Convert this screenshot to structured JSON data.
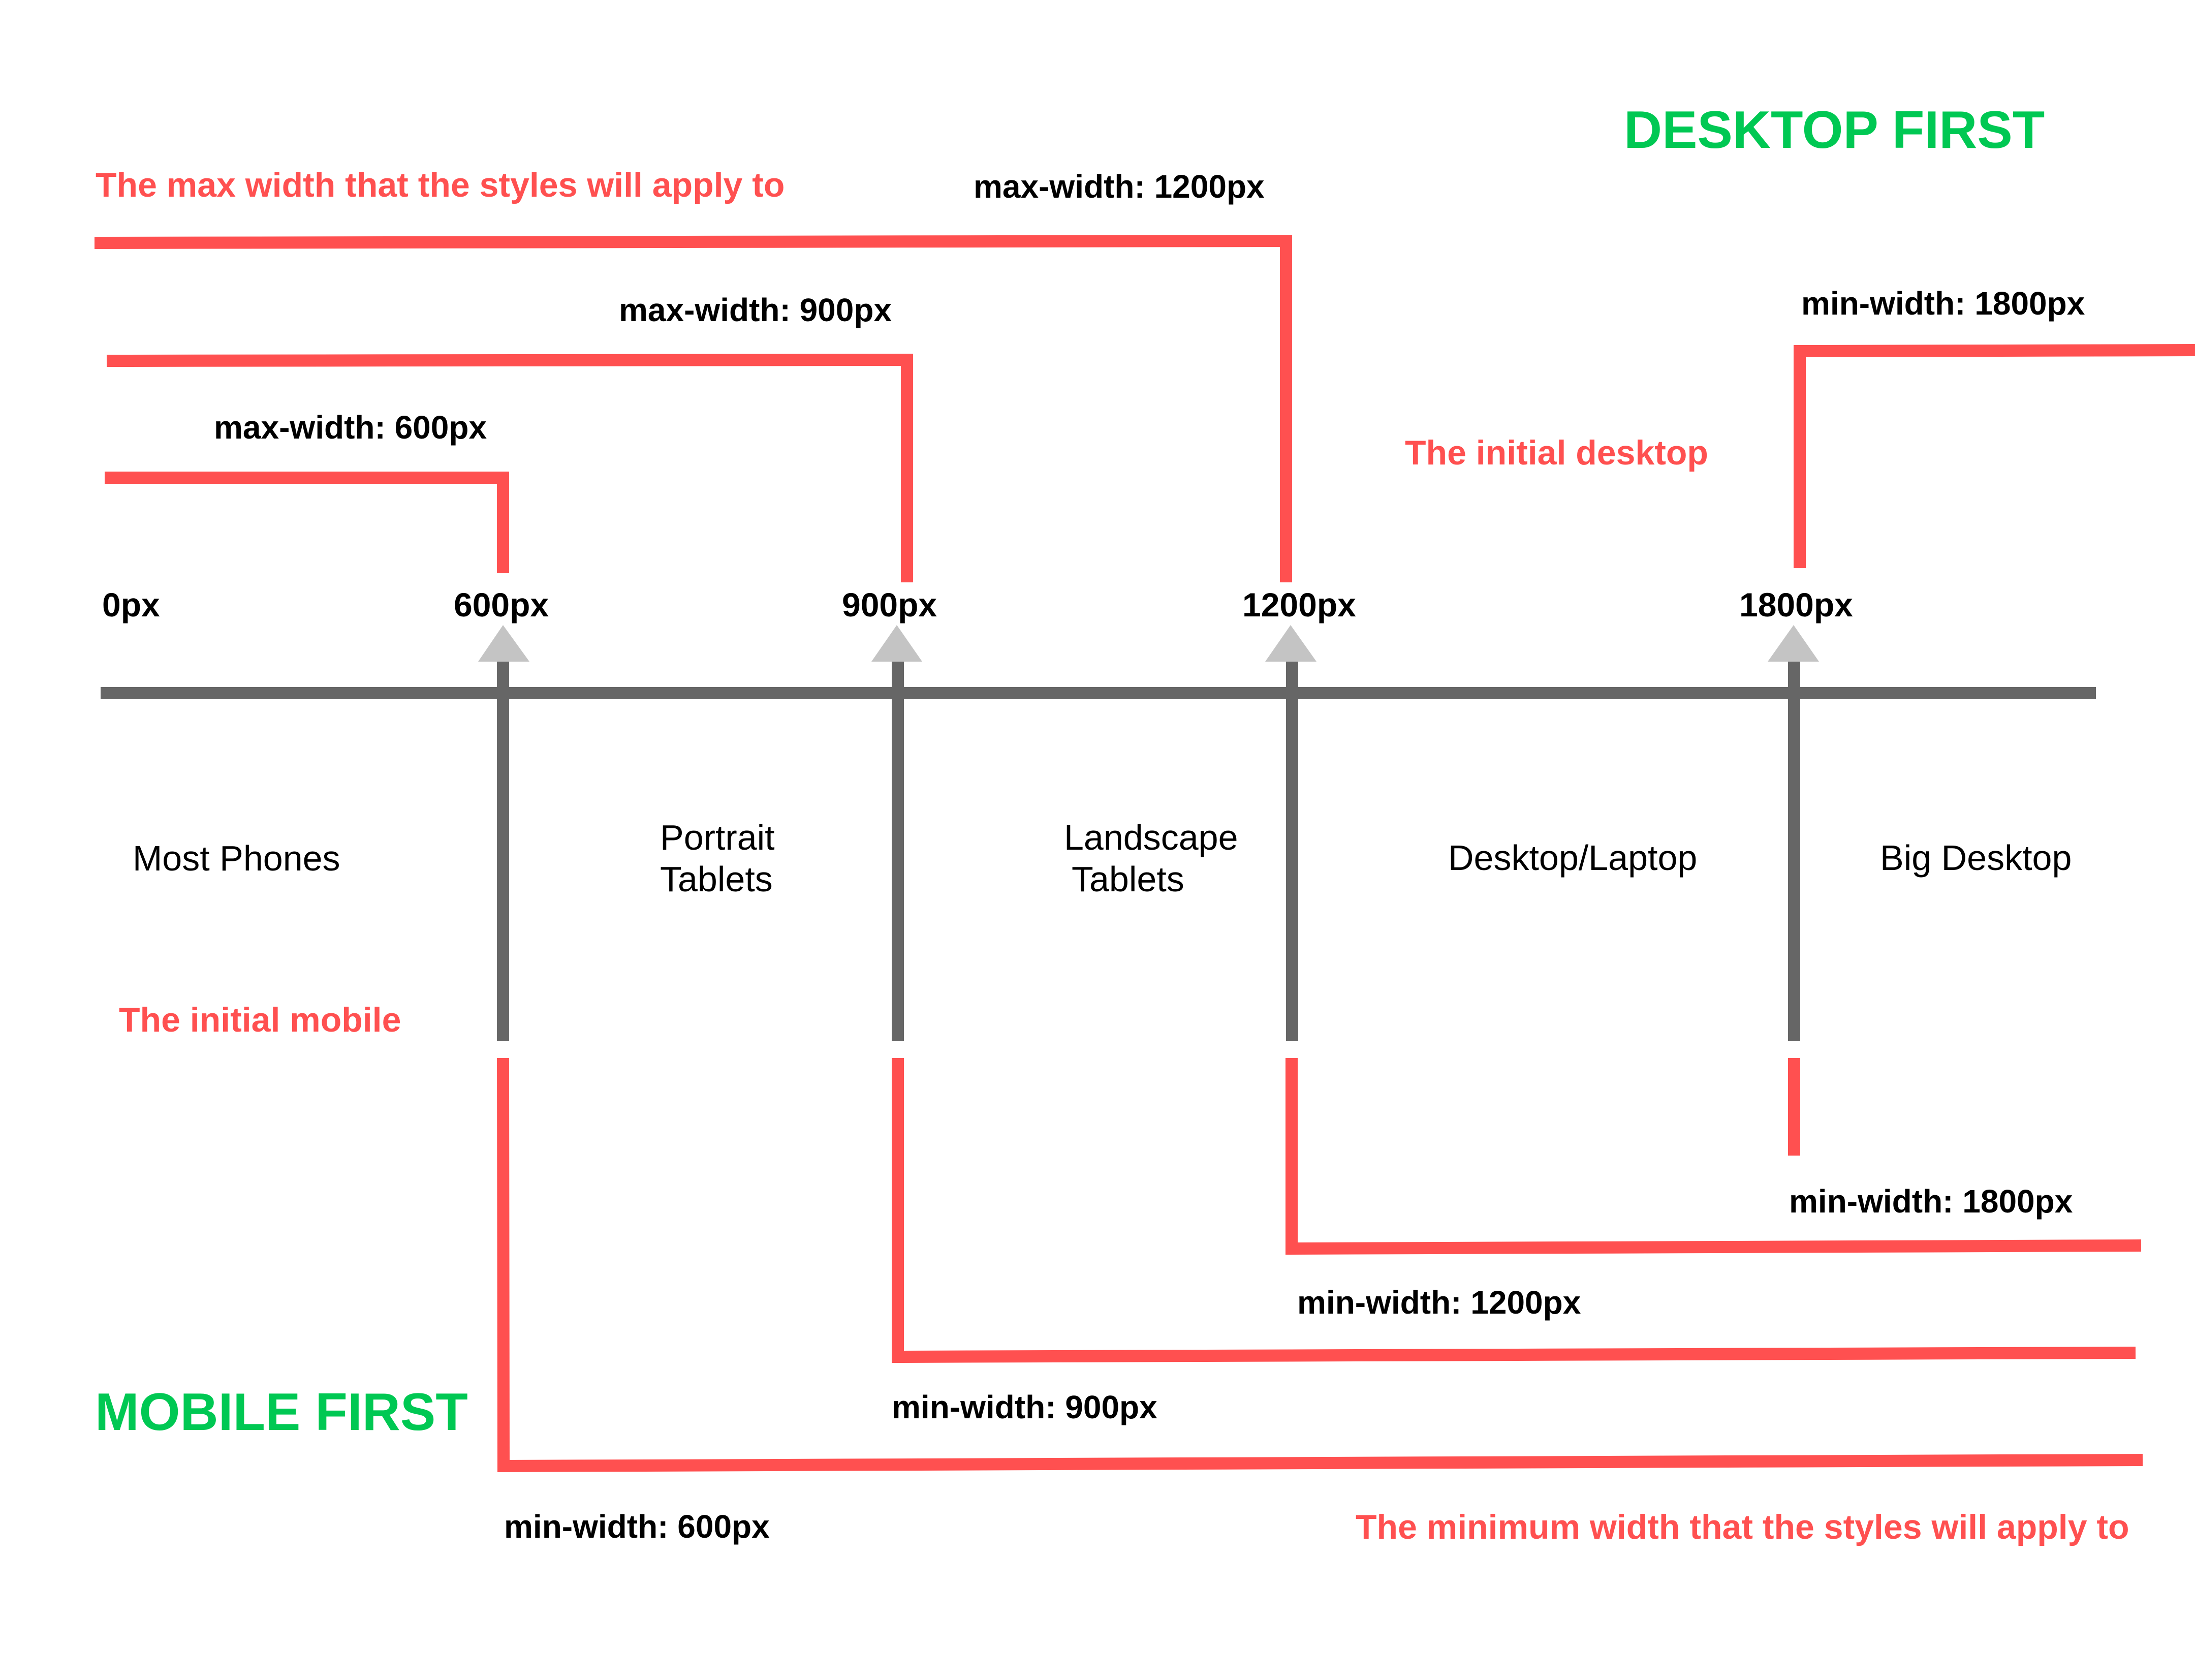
{
  "headings": {
    "desktop_first": "DESKTOP FIRST",
    "mobile_first": "MOBILE FIRST"
  },
  "notes": {
    "max_width_explainer": "The max width that the styles will apply to",
    "min_width_explainer": "The minimum width that the styles will apply to",
    "initial_desktop": "The initial desktop",
    "initial_mobile": "The initial mobile"
  },
  "axis": {
    "ticks": [
      {
        "label": "0px",
        "value": 0
      },
      {
        "label": "600px",
        "value": 600
      },
      {
        "label": "900px",
        "value": 900
      },
      {
        "label": "1200px",
        "value": 1200
      },
      {
        "label": "1800px",
        "value": 1800
      }
    ]
  },
  "devices": [
    {
      "line1": "Most Phones",
      "line2": ""
    },
    {
      "line1": "Portrait",
      "line2": "Tablets"
    },
    {
      "line1": "Landscape",
      "line2": "Tablets"
    },
    {
      "line1": "Desktop/Laptop",
      "line2": ""
    },
    {
      "line1": "Big Desktop",
      "line2": ""
    }
  ],
  "desktop_first_queries": [
    {
      "label": "max-width: 1200px",
      "breakpoint": 1200
    },
    {
      "label": "max-width: 900px",
      "breakpoint": 900
    },
    {
      "label": "max-width: 600px",
      "breakpoint": 600
    },
    {
      "label": "min-width: 1800px",
      "breakpoint": 1800
    }
  ],
  "mobile_first_queries": [
    {
      "label": "min-width: 600px",
      "breakpoint": 600
    },
    {
      "label": "min-width: 900px",
      "breakpoint": 900
    },
    {
      "label": "min-width: 1200px",
      "breakpoint": 1200
    },
    {
      "label": "min-width: 1800px",
      "breakpoint": 1800
    }
  ],
  "colors": {
    "query_line": "#FF5050",
    "axis": "#666666",
    "arrow": "#C4C4C4",
    "heading_green": "#00C853",
    "note_red": "#FF5050",
    "label_black": "#000000"
  }
}
